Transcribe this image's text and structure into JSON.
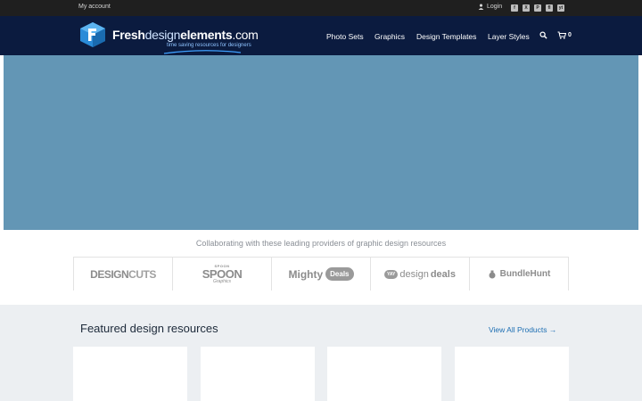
{
  "topbar": {
    "my_account": "My account",
    "login": "Login",
    "social": [
      "f",
      "X",
      "P",
      "fl",
      "yt"
    ]
  },
  "logo": {
    "name_part1": "Fresh",
    "name_part2": "design",
    "name_part3": "elements",
    "name_part4": ".com",
    "tagline": "time saving resources for designers"
  },
  "nav": {
    "items": [
      "Photo Sets",
      "Graphics",
      "Design Templates",
      "Layer Styles"
    ],
    "cart_count": "0"
  },
  "partners": {
    "heading": "Collaborating with these leading providers of graphic design resources",
    "design_cuts_a": "DESIGN",
    "design_cuts_b": "CUTS",
    "spoon_top": "SPOON",
    "spoon_main": "SPOON",
    "spoon_sub": "Graphics",
    "mighty": "Mighty",
    "mighty_badge": "Deals",
    "dd_tag": "YAY",
    "dd_light": "design",
    "dd_bold": "deals",
    "bundlehunt": "BundleHunt"
  },
  "featured": {
    "title": "Featured design resources",
    "view_all": "View All Products →"
  },
  "colors": {
    "topbar": "#1f1f1f",
    "header": "#0b1b3f",
    "hero": "#6396b5",
    "link": "#1e6fb3"
  }
}
